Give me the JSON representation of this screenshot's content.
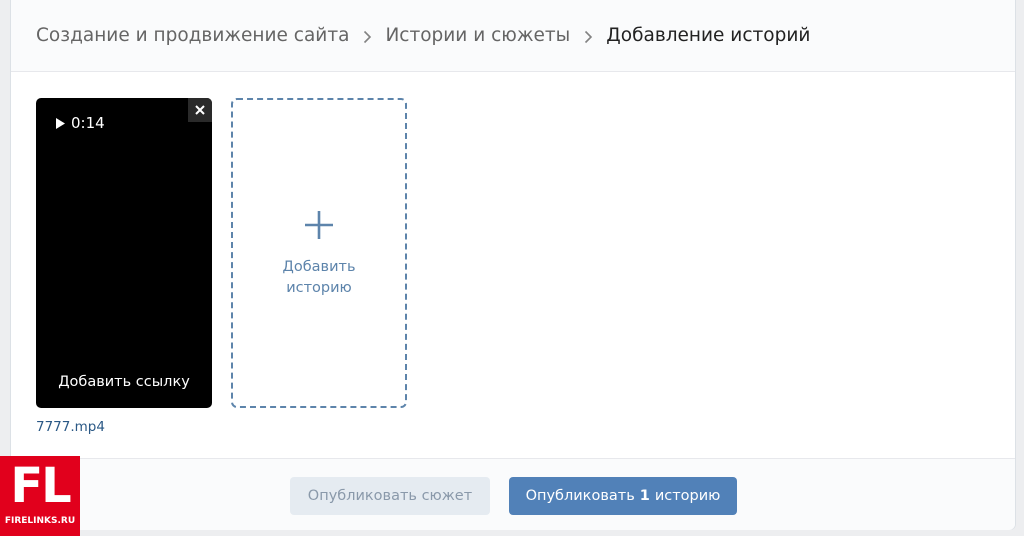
{
  "breadcrumb": {
    "items": [
      "Создание и продвижение сайта",
      "Истории и сюжеты",
      "Добавление историй"
    ]
  },
  "story": {
    "duration": "0:14",
    "add_link_label": "Добавить ссылку",
    "filename": "7777.mp4"
  },
  "add_story": {
    "line1": "Добавить",
    "line2": "историю"
  },
  "footer": {
    "publish_plot_label": "Опубликовать сюжет",
    "publish_stories_prefix": "Опубликовать",
    "publish_stories_count": "1",
    "publish_stories_suffix": "историю"
  },
  "logo": {
    "mark": "FL",
    "site": "FIRELINKS.RU"
  },
  "colors": {
    "accent": "#5181b8",
    "link": "#2a5885",
    "dashed_border": "#5d84ab",
    "logo_red": "#e1001c"
  }
}
